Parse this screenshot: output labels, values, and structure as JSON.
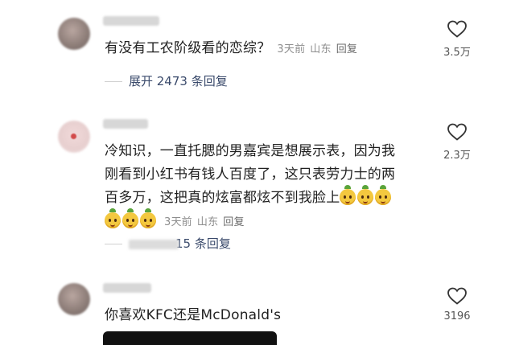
{
  "comments": [
    {
      "text": "有没有工农阶级看的恋综？",
      "time": "3天前",
      "location": "山东",
      "reply_label": "回复",
      "likes": "3.5万",
      "expand": "展开 2473 条回复"
    },
    {
      "text_line1": "冷知识，一直托腮的男嘉宾是想展示表，因为我",
      "text_line2": "刚看到小红书有钱人百度了，这只表劳力士的两",
      "text_line3": "百多万，这把真的炫富都炫不到我脸上",
      "time": "3天前",
      "location": "山东",
      "reply_label": "回复",
      "likes": "2.3万",
      "expand_suffix": "15 条回复"
    },
    {
      "text": "你喜欢KFC还是McDonald's",
      "likes": "3196"
    }
  ],
  "icons": {
    "like": "heart-outline-icon",
    "emoji": "mango-face-emoji"
  },
  "colors": {
    "meta_gray": "#8d8d8d",
    "link_blue_gray": "#3a4a6b"
  }
}
